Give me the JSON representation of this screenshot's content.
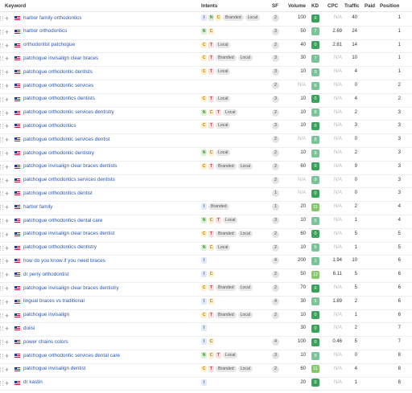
{
  "columns": {
    "keyword": "Keyword",
    "intents": "Intents",
    "sf": "SF",
    "volume": "Volume",
    "kd": "KD",
    "cpc": "CPC",
    "traffic": "Traffic",
    "paid": "Paid",
    "position": "Position"
  },
  "kd_colors": {
    "green": "#3aa35a",
    "lightgreen": "#86c96c",
    "teal": "#7bc49a"
  },
  "rows": [
    {
      "keyword": "harbor family orthodontics",
      "intents": [
        "I",
        "N",
        "C"
      ],
      "tags": [
        "Branded",
        "Local"
      ],
      "sf": "2",
      "volume": "100",
      "kd": "0",
      "cpc": "N/A",
      "traffic": "40",
      "paid": "",
      "position": "1"
    },
    {
      "keyword": "harbor orthodontics",
      "intents": [
        "N",
        "C"
      ],
      "tags": [],
      "sf": "3",
      "volume": "50",
      "kd": "7",
      "cpc": "2.69",
      "traffic": "24",
      "paid": "",
      "position": "1"
    },
    {
      "keyword": "orthodontist patchogue",
      "intents": [
        "C",
        "T"
      ],
      "tags": [
        "Local"
      ],
      "sf": "2",
      "volume": "40",
      "kd": "0",
      "cpc": "2.81",
      "traffic": "14",
      "paid": "",
      "position": "1"
    },
    {
      "keyword": "patchogue invisalign clear braces",
      "intents": [
        "C",
        "T"
      ],
      "tags": [
        "Branded",
        "Local"
      ],
      "sf": "3",
      "volume": "30",
      "kd": "7",
      "cpc": "N/A",
      "traffic": "10",
      "paid": "",
      "position": "1"
    },
    {
      "keyword": "patchogue orthodontic dentists",
      "intents": [
        "C",
        "T"
      ],
      "tags": [
        "Local"
      ],
      "sf": "3",
      "volume": "10",
      "kd": "9",
      "cpc": "N/A",
      "traffic": "4",
      "paid": "",
      "position": "1"
    },
    {
      "keyword": "patchogue orthodontic services",
      "intents": [],
      "tags": [],
      "sf": "2",
      "volume": "N/A",
      "kd": "6",
      "cpc": "N/A",
      "traffic": "0",
      "paid": "",
      "position": "2"
    },
    {
      "keyword": "patchogue orthodontics dentists",
      "intents": [
        "C",
        "T"
      ],
      "tags": [
        "Local"
      ],
      "sf": "3",
      "volume": "10",
      "kd": "0",
      "cpc": "N/A",
      "traffic": "4",
      "paid": "",
      "position": "2"
    },
    {
      "keyword": "patchogue orthodontic services dentistry",
      "intents": [
        "N",
        "C",
        "T"
      ],
      "tags": [
        "Local"
      ],
      "sf": "2",
      "volume": "10",
      "kd": "8",
      "cpc": "N/A",
      "traffic": "2",
      "paid": "",
      "position": "3"
    },
    {
      "keyword": "patchogue orthodontics",
      "intents": [
        "C",
        "T"
      ],
      "tags": [
        "Local"
      ],
      "sf": "3",
      "volume": "10",
      "kd": "0",
      "cpc": "N/A",
      "traffic": "3",
      "paid": "",
      "position": "3"
    },
    {
      "keyword": "patchogue orthodontic services dentist",
      "intents": [],
      "tags": [],
      "sf": "2",
      "volume": "N/A",
      "kd": "8",
      "cpc": "N/A",
      "traffic": "0",
      "paid": "",
      "position": "3"
    },
    {
      "keyword": "patchogue orthodontic dentistry",
      "intents": [
        "N",
        "C"
      ],
      "tags": [
        "Local"
      ],
      "sf": "2",
      "volume": "10",
      "kd": "9",
      "cpc": "N/A",
      "traffic": "2",
      "paid": "",
      "position": "3"
    },
    {
      "keyword": "patchogue invisalign clear braces dentists",
      "intents": [
        "C",
        "T"
      ],
      "tags": [
        "Branded",
        "Local"
      ],
      "sf": "2",
      "volume": "60",
      "kd": "0",
      "cpc": "N/A",
      "traffic": "9",
      "paid": "",
      "position": "3"
    },
    {
      "keyword": "patchogue orthodontics services dentists",
      "intents": [],
      "tags": [],
      "sf": "2",
      "volume": "N/A",
      "kd": "9",
      "cpc": "N/A",
      "traffic": "0",
      "paid": "",
      "position": "3"
    },
    {
      "keyword": "patchogue orthodontics dentist",
      "intents": [],
      "tags": [],
      "sf": "1",
      "volume": "N/A",
      "kd": "0",
      "cpc": "N/A",
      "traffic": "0",
      "paid": "",
      "position": "3"
    },
    {
      "keyword": "harbor family",
      "intents": [
        "I"
      ],
      "tags": [
        "Branded"
      ],
      "sf": "1",
      "volume": "20",
      "kd": "11",
      "cpc": "N/A",
      "traffic": "2",
      "paid": "",
      "position": "4"
    },
    {
      "keyword": "patchogue orthodontics dental care",
      "intents": [
        "N",
        "C",
        "T"
      ],
      "tags": [
        "Local"
      ],
      "sf": "3",
      "volume": "10",
      "kd": "5",
      "cpc": "N/A",
      "traffic": "1",
      "paid": "",
      "position": "4"
    },
    {
      "keyword": "patchogue invisalign clear braces dentist",
      "intents": [
        "C",
        "T"
      ],
      "tags": [
        "Branded",
        "Local"
      ],
      "sf": "2",
      "volume": "60",
      "kd": "0",
      "cpc": "N/A",
      "traffic": "5",
      "paid": "",
      "position": "5"
    },
    {
      "keyword": "patchogue orthodontics dentistry",
      "intents": [
        "N",
        "C"
      ],
      "tags": [
        "Local"
      ],
      "sf": "2",
      "volume": "10",
      "kd": "5",
      "cpc": "N/A",
      "traffic": "1",
      "paid": "",
      "position": "5"
    },
    {
      "keyword": "how do you know if you need braces",
      "intents": [
        "I"
      ],
      "tags": [],
      "sf": "4",
      "volume": "200",
      "kd": "1",
      "cpc": "1.94",
      "traffic": "10",
      "paid": "",
      "position": "6"
    },
    {
      "keyword": "dr perry orthodontist",
      "intents": [
        "I",
        "C"
      ],
      "tags": [],
      "sf": "2",
      "volume": "50",
      "kd": "12",
      "cpc": "6.11",
      "traffic": "5",
      "paid": "",
      "position": "6"
    },
    {
      "keyword": "patchogue invisalign clear braces dentistry",
      "intents": [
        "C",
        "T"
      ],
      "tags": [
        "Branded",
        "Local"
      ],
      "sf": "2",
      "volume": "70",
      "kd": "0",
      "cpc": "N/A",
      "traffic": "5",
      "paid": "",
      "position": "6"
    },
    {
      "keyword": "lingual braces vs traditional",
      "intents": [
        "I",
        "C"
      ],
      "tags": [],
      "sf": "4",
      "volume": "30",
      "kd": "5",
      "cpc": "1.89",
      "traffic": "2",
      "paid": "",
      "position": "6"
    },
    {
      "keyword": "patchogue invisalign",
      "intents": [
        "C",
        "T"
      ],
      "tags": [
        "Branded",
        "Local"
      ],
      "sf": "2",
      "volume": "10",
      "kd": "0",
      "cpc": "N/A",
      "traffic": "1",
      "paid": "",
      "position": "6"
    },
    {
      "keyword": "doiisi",
      "intents": [
        "I"
      ],
      "tags": [],
      "sf": "",
      "volume": "30",
      "kd": "0",
      "cpc": "N/A",
      "traffic": "2",
      "paid": "",
      "position": "7"
    },
    {
      "keyword": "power chains colors",
      "intents": [
        "I",
        "C"
      ],
      "tags": [],
      "sf": "4",
      "volume": "100",
      "kd": "0",
      "cpc": "0.46",
      "traffic": "5",
      "paid": "",
      "position": "7"
    },
    {
      "keyword": "patchogue orthodontic services dental care",
      "intents": [
        "N",
        "C",
        "T"
      ],
      "tags": [
        "Local"
      ],
      "sf": "3",
      "volume": "10",
      "kd": "9",
      "cpc": "N/A",
      "traffic": "0",
      "paid": "",
      "position": "8"
    },
    {
      "keyword": "patchogue invisalign dentist",
      "intents": [
        "C",
        "T"
      ],
      "tags": [
        "Branded",
        "Local"
      ],
      "sf": "2",
      "volume": "60",
      "kd": "11",
      "cpc": "N/A",
      "traffic": "4",
      "paid": "",
      "position": "8"
    },
    {
      "keyword": "dr kastin",
      "intents": [
        "I"
      ],
      "tags": [],
      "sf": "",
      "volume": "20",
      "kd": "0",
      "cpc": "N/A",
      "traffic": "1",
      "paid": "",
      "position": "8"
    }
  ]
}
